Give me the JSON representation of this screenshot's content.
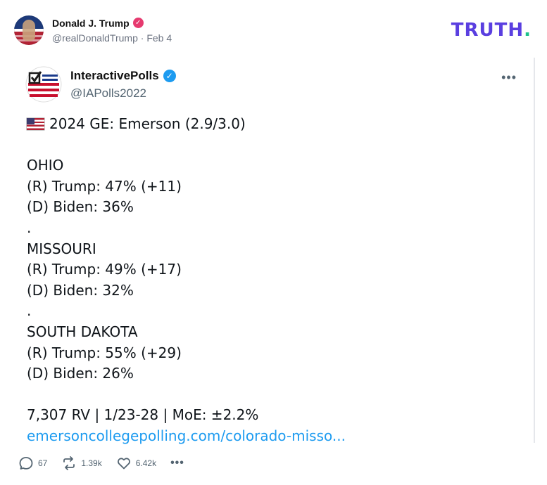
{
  "post": {
    "author_name": "Donald J. Trump",
    "handle": "@realDonaldTrump",
    "separator": "·",
    "date": "Feb 4"
  },
  "brand": {
    "logo_text": "TRUTH",
    "logo_dot": "."
  },
  "embed": {
    "name": "InteractivePolls",
    "handle": "@IAPolls2022",
    "more_label": "•••",
    "lines": [
      "2024 GE: Emerson (2.9/3.0)",
      "",
      "OHIO",
      "(R) Trump: 47% (+11)",
      "(D) Biden: 36%",
      ".",
      "MISSOURI",
      "(R) Trump: 49% (+17)",
      "(D) Biden: 32%",
      ".",
      "SOUTH DAKOTA",
      "(R) Trump: 55% (+29)",
      "(D) Biden: 26%",
      "",
      "7,307 RV | 1/23-28 | MoE: ±2.2%"
    ],
    "link": "emersoncollegepolling.com/colorado-misso..."
  },
  "actions": {
    "replies": "67",
    "retruths": "1.39k",
    "likes": "6.42k",
    "more_label": "•••"
  },
  "colors": {
    "brand_purple": "#5a3fe0",
    "brand_green": "#1ec28b",
    "verified_pink": "#e63a6f",
    "verified_blue": "#1d9bf0",
    "link_blue": "#1d9bf0",
    "meta_gray": "#6b7280"
  },
  "icons": [
    "verified-badge-icon",
    "us-flag-icon",
    "reply-icon",
    "retruth-icon",
    "like-icon",
    "more-icon"
  ]
}
